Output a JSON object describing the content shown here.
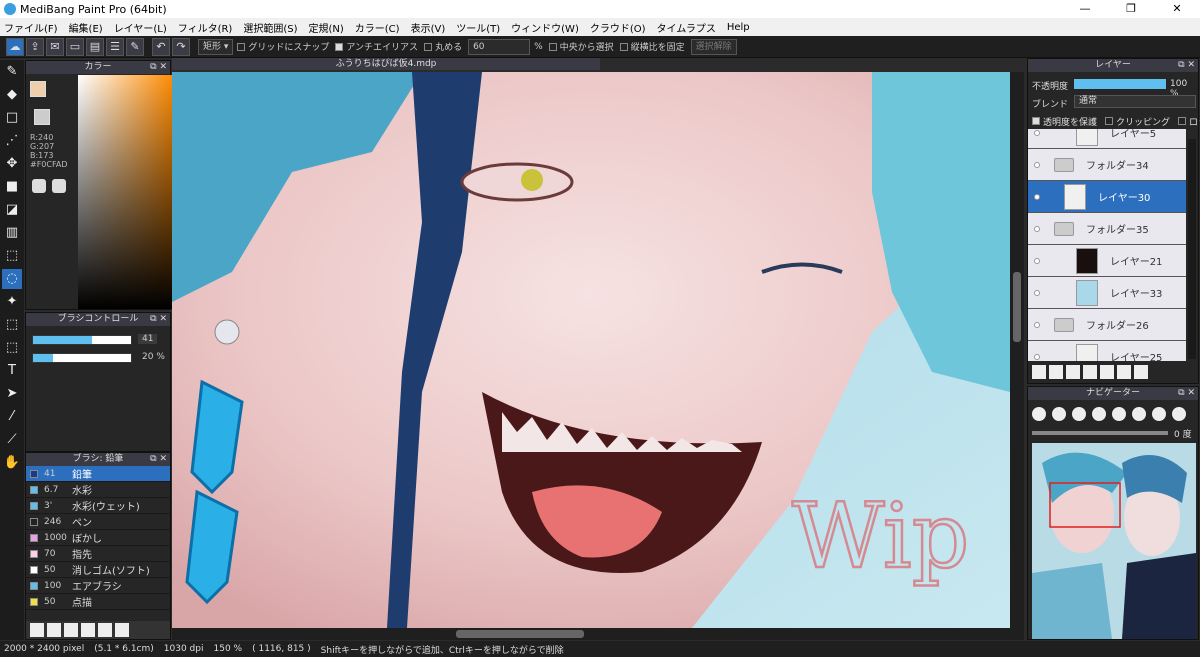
{
  "window": {
    "title": "MediBang Paint Pro (64bit)",
    "min": "—",
    "max": "❐",
    "close": "✕"
  },
  "menu": [
    "ファイル(F)",
    "編集(E)",
    "レイヤー(L)",
    "フィルタ(R)",
    "選択範囲(S)",
    "定規(N)",
    "カラー(C)",
    "表示(V)",
    "ツール(T)",
    "ウィンドウ(W)",
    "クラウド(O)",
    "タイムラプス",
    "Help"
  ],
  "toolbar": {
    "shape_select": "矩形",
    "grid_snap": "グリッドにスナップ",
    "antialias": "アンチエイリアス",
    "round_label": "丸める",
    "round_value": "60",
    "percent": "%",
    "center_select": "中央から選択",
    "fix_ratio": "縦横比を固定",
    "deselect": "選択解除"
  },
  "color_panel": {
    "title": "カラー",
    "r": "R:240",
    "g": "G:207",
    "b": "B:173",
    "hex": "#F0CFAD",
    "current_color": "#f0cfad"
  },
  "brush_control": {
    "title": "ブラシコントロール",
    "size_value": "41",
    "opacity_value": "20 %",
    "size_fraction": 0.6,
    "opacity_fraction": 0.2
  },
  "brush_panel": {
    "title": "ブラシ: 鉛筆",
    "items": [
      {
        "size": "41",
        "name": "鉛筆",
        "color": "#1a3a8a",
        "selected": true
      },
      {
        "size": "6.7",
        "name": "水彩",
        "color": "#5fbfef"
      },
      {
        "size": "3'",
        "name": "水彩(ウェット)",
        "color": "#5fbfef"
      },
      {
        "size": "246",
        "name": "ペン",
        "color": "#222222"
      },
      {
        "size": "1000",
        "name": "ぼかし",
        "color": "#e8a0e8"
      },
      {
        "size": "70",
        "name": "指先",
        "color": "#ffd0e8"
      },
      {
        "size": "50",
        "name": "消しゴム(ソフト)",
        "color": "#ffffff"
      },
      {
        "size": "100",
        "name": "エアブラシ",
        "color": "#5fbfef"
      },
      {
        "size": "50",
        "name": "点描",
        "color": "#f0e040"
      }
    ]
  },
  "document": {
    "tab": "ふうりちはぴば仮4.mdp",
    "watermark": "Wip"
  },
  "layer_panel": {
    "title": "レイヤー",
    "opacity_label": "不透明度",
    "opacity_value": "100 %",
    "blend_label": "ブレンド",
    "blend_value": "通常",
    "protect": "透明度を保護",
    "clipping": "クリッピング",
    "lock": "ロック",
    "layers": [
      {
        "name": "レイヤー5",
        "type": "layer"
      },
      {
        "name": "フォルダー34",
        "type": "folder"
      },
      {
        "name": "レイヤー30",
        "type": "layer",
        "selected": true
      },
      {
        "name": "フォルダー35",
        "type": "folder"
      },
      {
        "name": "レイヤー21",
        "type": "layer"
      },
      {
        "name": "レイヤー33",
        "type": "layer"
      },
      {
        "name": "フォルダー26",
        "type": "folder"
      },
      {
        "name": "レイヤー25",
        "type": "layer"
      }
    ]
  },
  "navigator": {
    "title": "ナビゲーター",
    "angle": "0 度"
  },
  "status": {
    "size": "2000 * 2400 pixel",
    "cm": "(5.1 * 6.1cm)",
    "dpi": "1030 dpi",
    "zoom": "150 %",
    "coords": "( 1116, 815 )",
    "hint": "Shiftキーを押しながらで追加、Ctrlキーを押しながらで削除"
  }
}
